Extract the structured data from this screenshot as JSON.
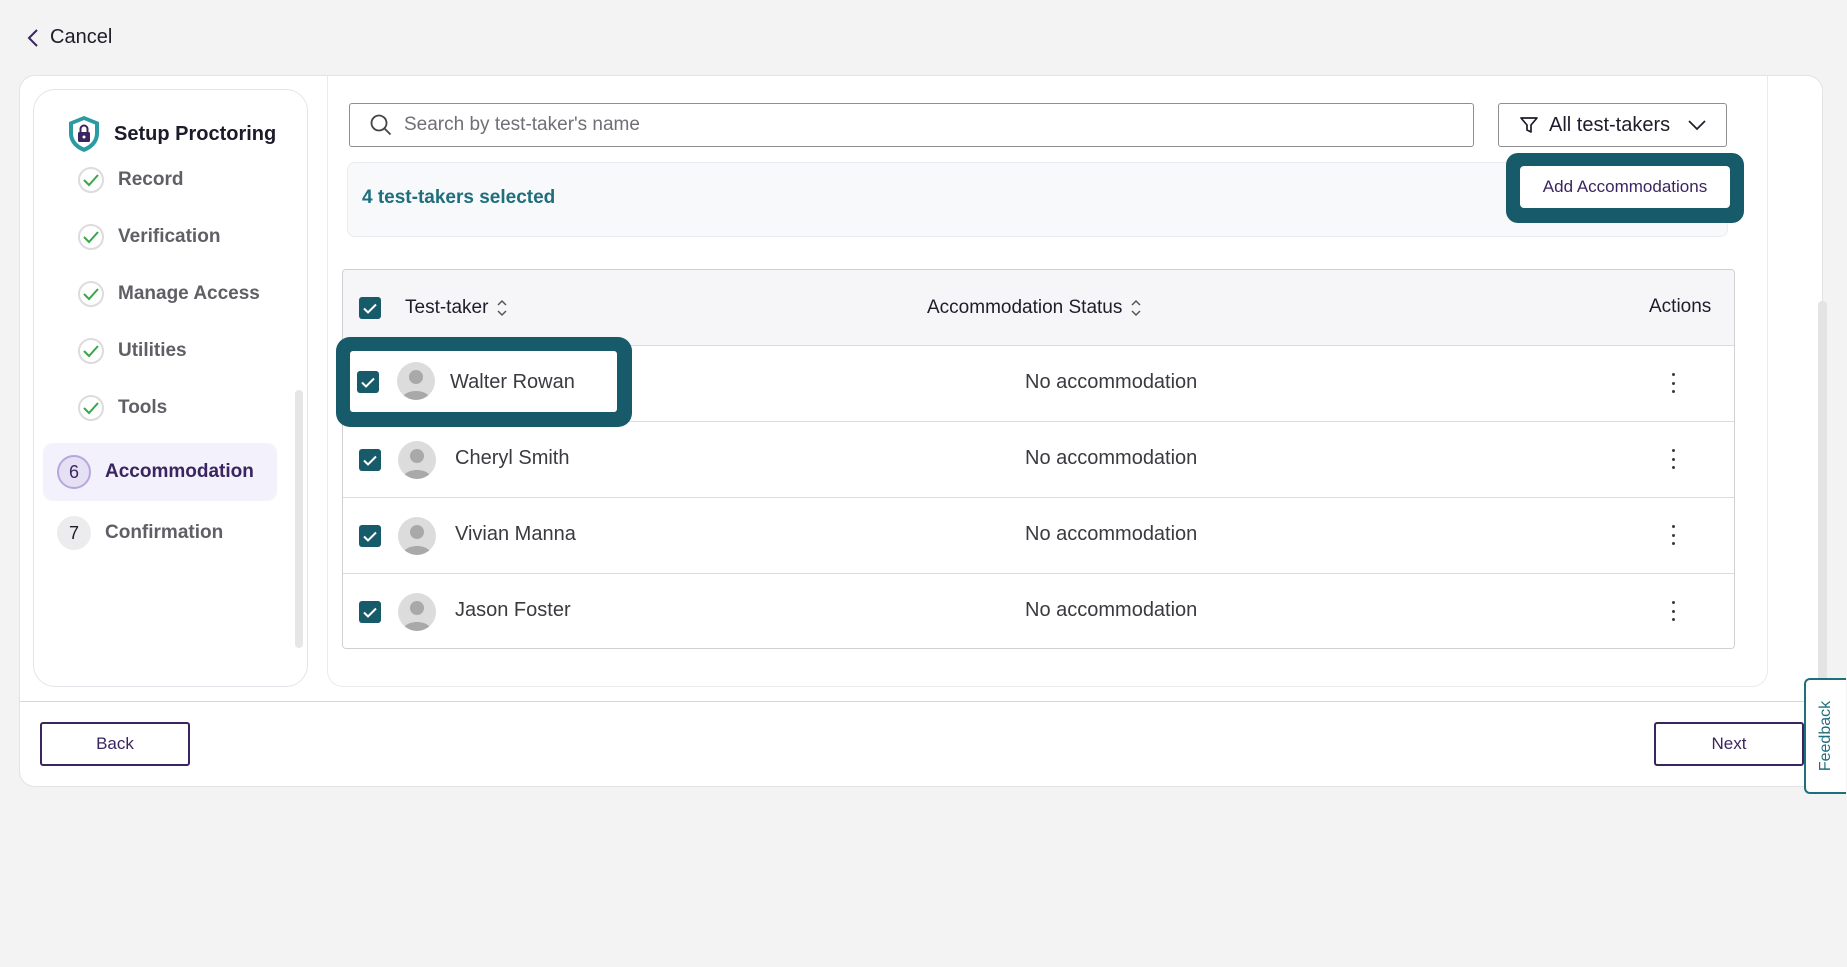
{
  "header": {
    "cancel_label": "Cancel"
  },
  "sidebar": {
    "title": "Setup Proctoring",
    "completed_steps": [
      "Record",
      "Verification",
      "Manage Access",
      "Utilities",
      "Tools"
    ],
    "numbered_steps": [
      {
        "number": "6",
        "label": "Accommodation",
        "active": true
      },
      {
        "number": "7",
        "label": "Confirmation",
        "active": false
      }
    ]
  },
  "search": {
    "placeholder": "Search by test-taker's name",
    "value": ""
  },
  "filter": {
    "label": "All test-takers"
  },
  "selection": {
    "text": "4 test-takers selected",
    "action_label": "Add Accommodations"
  },
  "table": {
    "columns": {
      "name": "Test-taker",
      "status": "Accommodation Status",
      "actions": "Actions"
    },
    "rows": [
      {
        "name": "Walter Rowan",
        "status": "No accommodation",
        "checked": true
      },
      {
        "name": "Cheryl Smith",
        "status": "No accommodation",
        "checked": true
      },
      {
        "name": "Vivian Manna",
        "status": "No accommodation",
        "checked": true
      },
      {
        "name": "Jason Foster",
        "status": "No accommodation",
        "checked": true
      }
    ]
  },
  "footer": {
    "back_label": "Back",
    "next_label": "Next"
  },
  "feedback_label": "Feedback",
  "colors": {
    "accent_teal": "#175a69",
    "brand_purple": "#3b2560",
    "check_green": "#3aa64a"
  }
}
